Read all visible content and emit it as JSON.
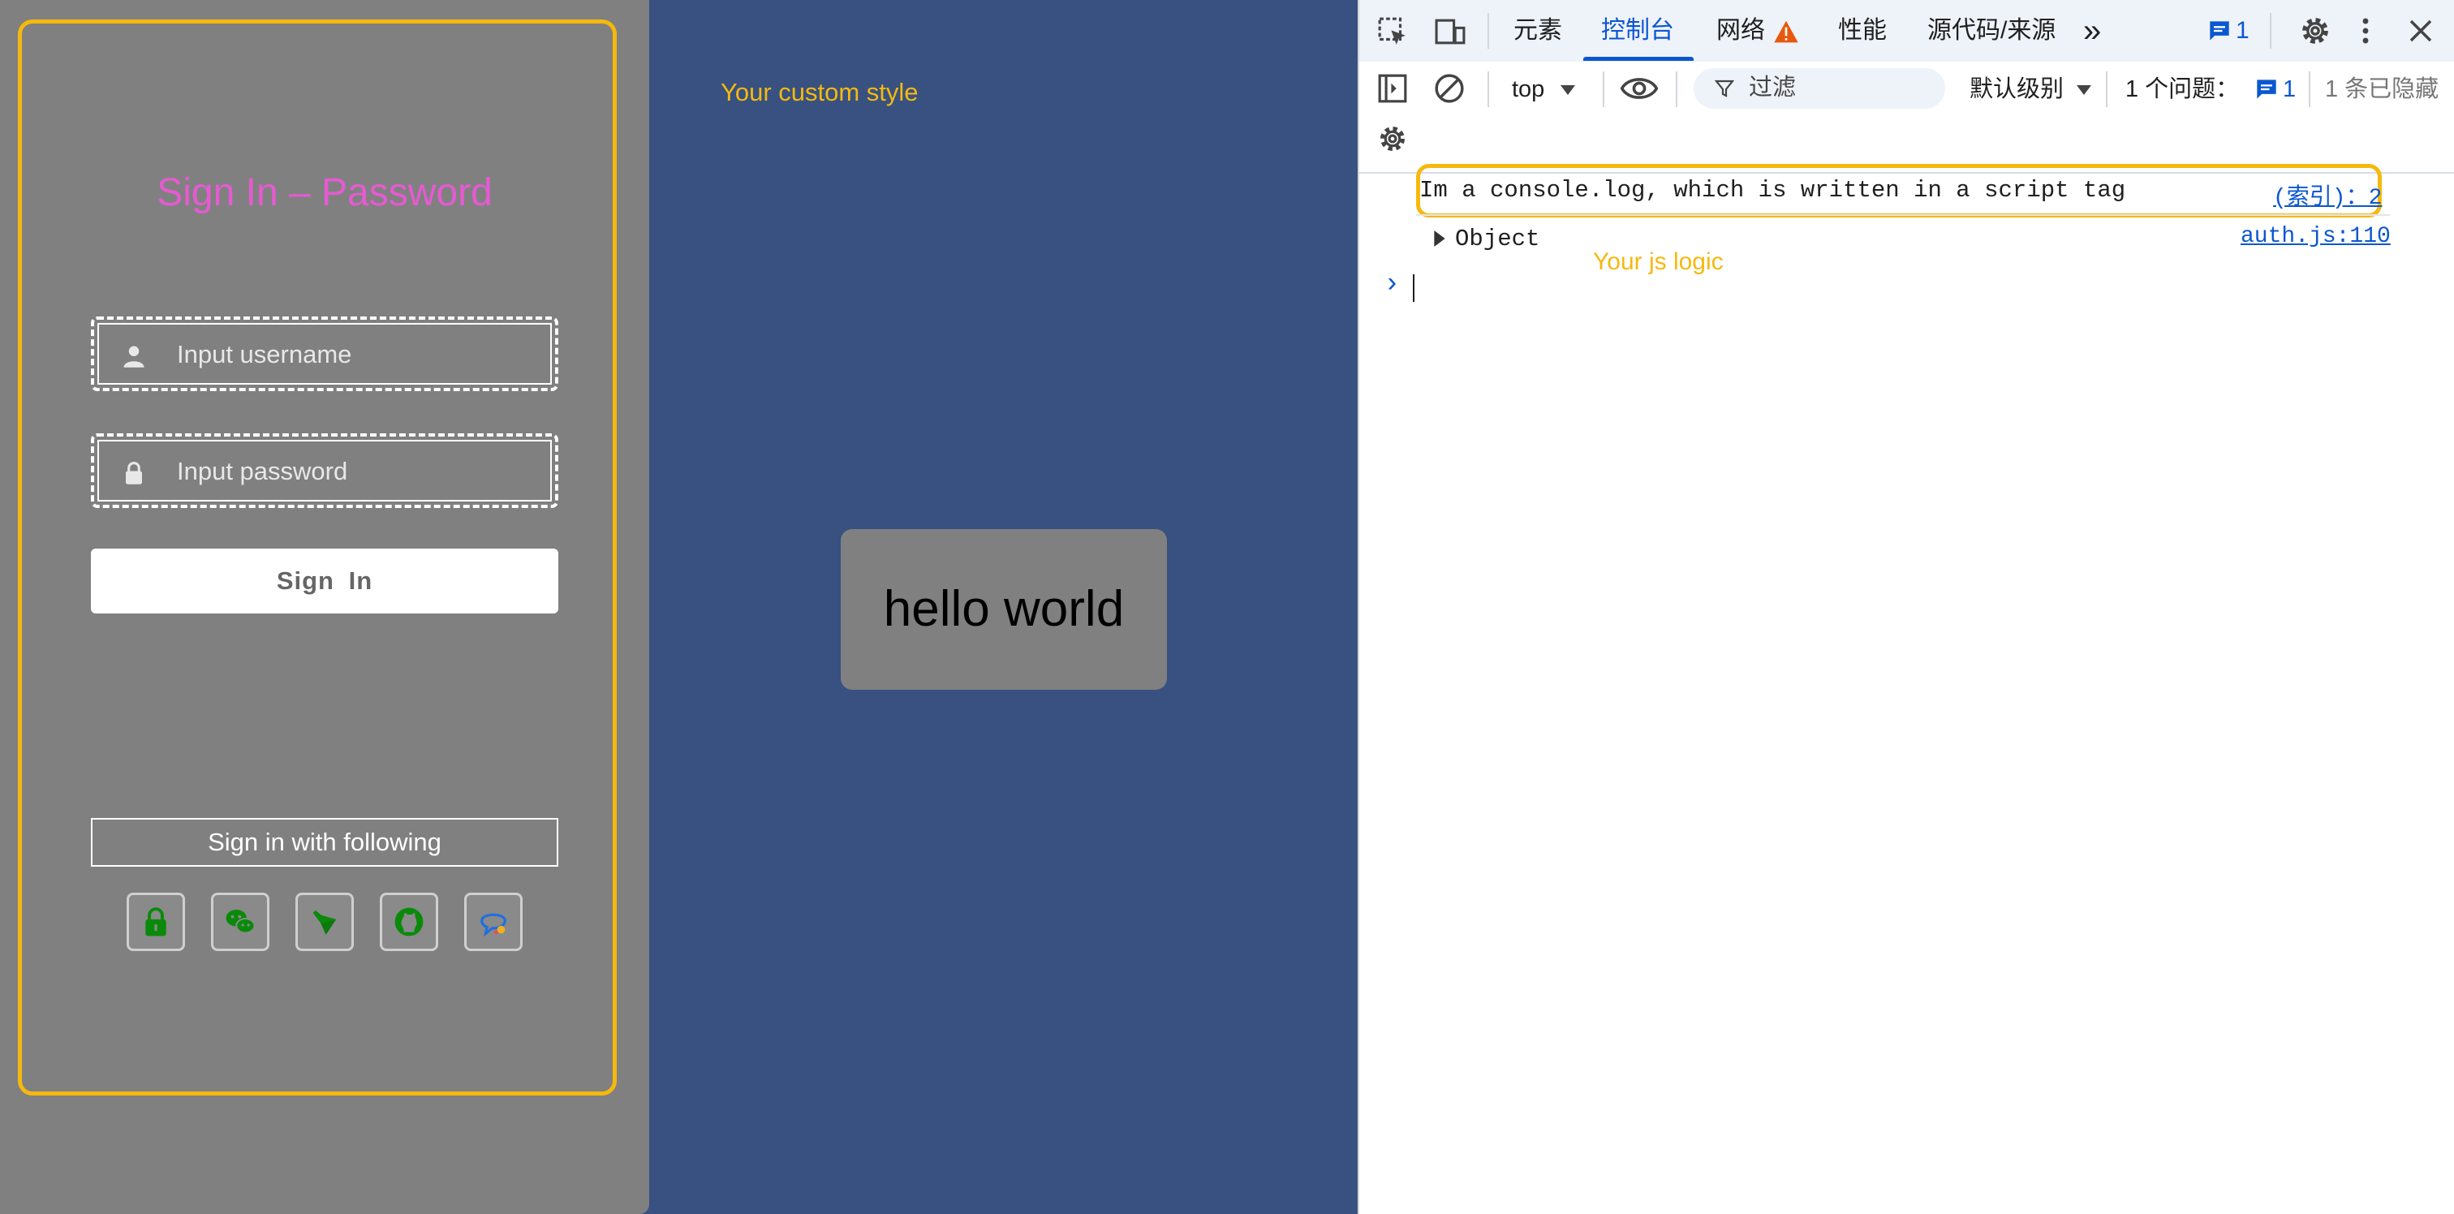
{
  "login": {
    "title": "Sign In – Password",
    "username_placeholder": "Input username",
    "password_placeholder": "Input password",
    "signin_label": "Sign  In",
    "following_label": "Sign in with following",
    "providers": [
      "lock-icon",
      "wechat-icon",
      "feishu-icon",
      "github-icon",
      "chat-icon"
    ],
    "title_color": "#e65ad2",
    "outline_color": "#f5b90e",
    "provider_icon_color": "#0a8a0a"
  },
  "middle": {
    "custom_style_label": "Your custom style",
    "hello_text": "hello world"
  },
  "devtools": {
    "tabs": {
      "elements": "元素",
      "console": "控制台",
      "network": "网络",
      "performance": "性能",
      "sources": "源代码/来源",
      "more": "»"
    },
    "issues_count": "1",
    "toolbar": {
      "context": "top",
      "filter_placeholder": "过滤",
      "level": "默认级别",
      "issues_label": "1 个问题：",
      "issues_badge": "1",
      "hidden_label": "1 条已隐藏"
    },
    "console": {
      "log_message": "Im a console.log, which is written in a script tag",
      "log_source": "(索引)：2",
      "object_label": "Object",
      "object_source": "auth.js:110",
      "js_logic_label": "Your js logic",
      "prompt": "›"
    },
    "accent_color": "#0b57d0"
  }
}
